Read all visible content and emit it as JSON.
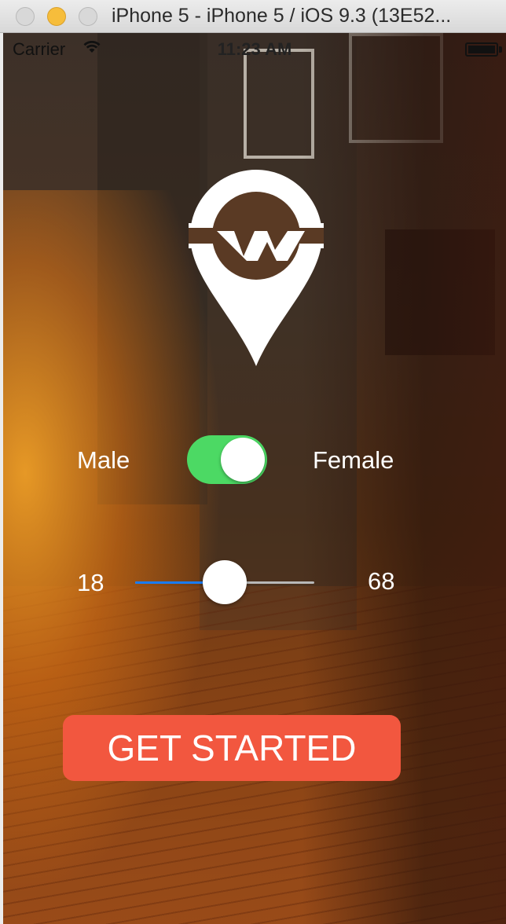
{
  "window": {
    "title": "iPhone 5 - iPhone 5 / iOS 9.3 (13E52..."
  },
  "status_bar": {
    "carrier": "Carrier",
    "time": "11:23 AM"
  },
  "gender": {
    "left_label": "Male",
    "right_label": "Female",
    "on": true,
    "on_color": "#4cd964"
  },
  "age": {
    "min_label": "18",
    "max_label": "68",
    "value_fraction": 0.5,
    "fill_color": "#1a7cf5",
    "track_color": "#b8b8b8"
  },
  "cta": {
    "label": "GET STARTED",
    "color": "#f2573f"
  },
  "logo": {
    "icon": "map-pin-w-logo"
  }
}
